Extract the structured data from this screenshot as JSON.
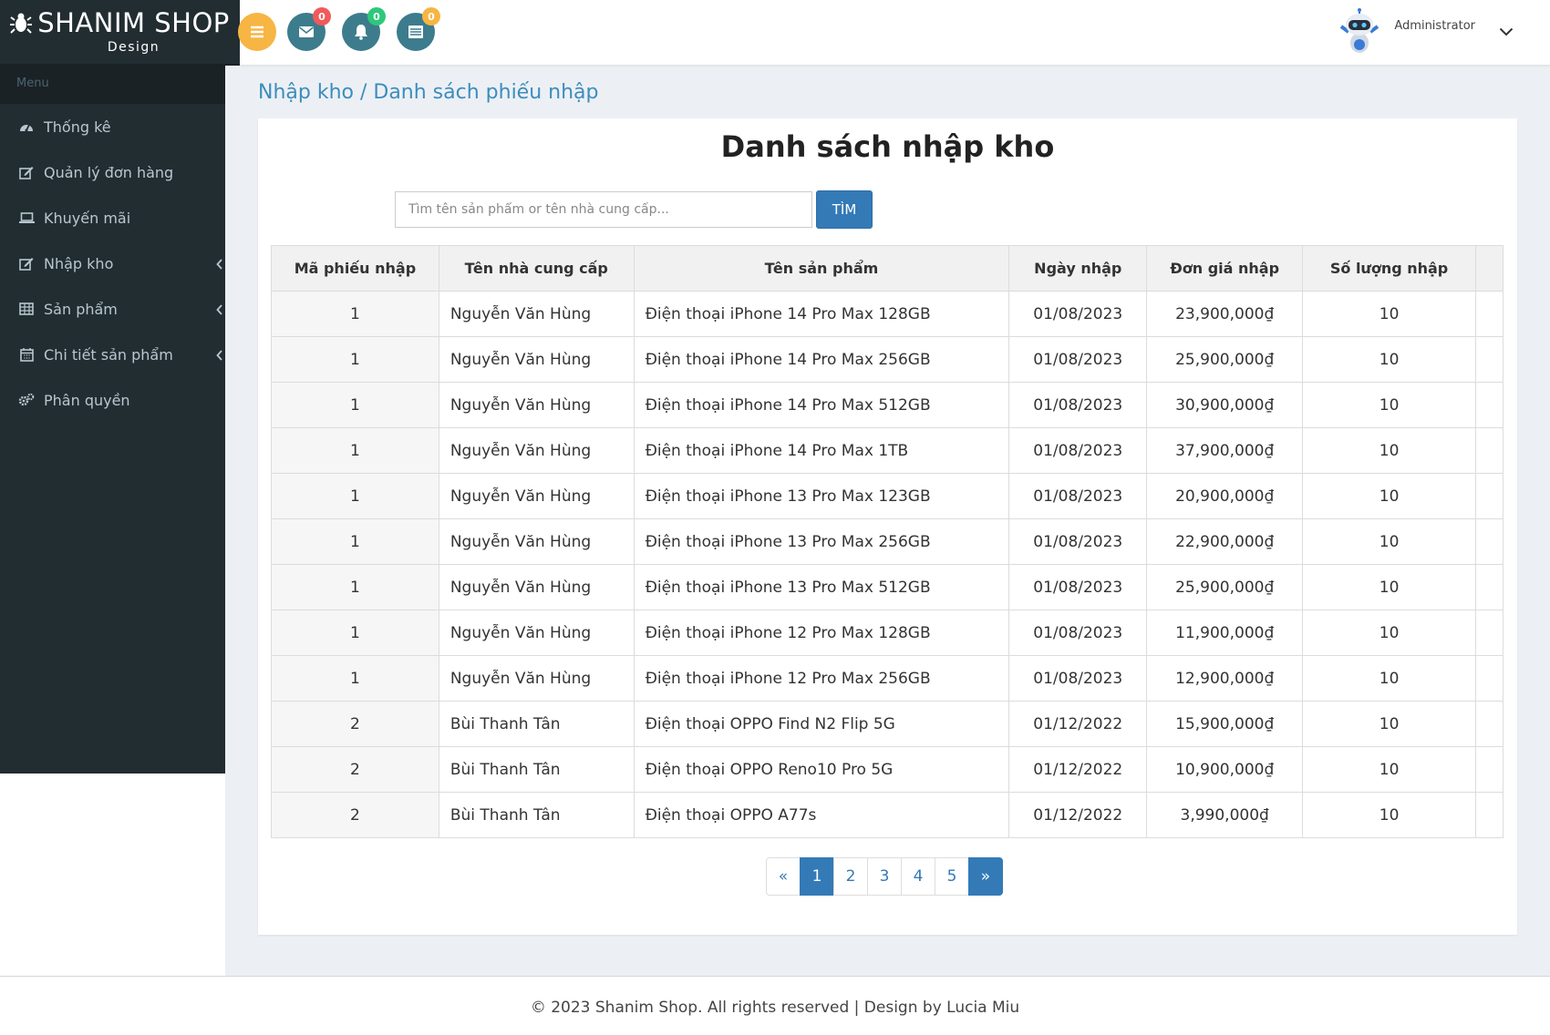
{
  "brand": {
    "title": "SHANIM SHOP",
    "subtitle": "Design"
  },
  "sidebar": {
    "header": "Menu",
    "items": [
      {
        "label": "Thống kê",
        "icon": "dashboard-icon"
      },
      {
        "label": "Quản lý đơn hàng",
        "icon": "edit-icon"
      },
      {
        "label": "Khuyến mãi",
        "icon": "laptop-icon"
      },
      {
        "label": "Nhập kho",
        "icon": "edit-icon",
        "chevron": true
      },
      {
        "label": "Sản phẩm",
        "icon": "table-icon",
        "chevron": true
      },
      {
        "label": "Chi tiết sản phẩm",
        "icon": "calendar-icon",
        "chevron": true
      },
      {
        "label": "Phân quyền",
        "icon": "cogs-icon"
      }
    ]
  },
  "topbar": {
    "badges": {
      "mail": "0",
      "bell": "0",
      "tasks": "0"
    },
    "user_name": "Administrator"
  },
  "breadcrumb": "Nhập kho / Danh sách phiếu nhập",
  "panel": {
    "title": "Danh sách nhập kho",
    "search_placeholder": "Tìm tên sản phẩm or tên nhà cung cấp...",
    "search_button": "TÌM"
  },
  "table": {
    "headers": [
      "Mã phiếu nhập",
      "Tên nhà cung cấp",
      "Tên sản phẩm",
      "Ngày nhập",
      "Đơn giá nhập",
      "Số lượng nhập",
      ""
    ],
    "rows": [
      [
        "1",
        "Nguyễn Văn Hùng",
        "Điện thoại iPhone 14 Pro Max 128GB",
        "01/08/2023",
        "23,900,000₫",
        "10"
      ],
      [
        "1",
        "Nguyễn Văn Hùng",
        "Điện thoại iPhone 14 Pro Max 256GB",
        "01/08/2023",
        "25,900,000₫",
        "10"
      ],
      [
        "1",
        "Nguyễn Văn Hùng",
        "Điện thoại iPhone 14 Pro Max 512GB",
        "01/08/2023",
        "30,900,000₫",
        "10"
      ],
      [
        "1",
        "Nguyễn Văn Hùng",
        "Điện thoại iPhone 14 Pro Max 1TB",
        "01/08/2023",
        "37,900,000₫",
        "10"
      ],
      [
        "1",
        "Nguyễn Văn Hùng",
        "Điện thoại iPhone 13 Pro Max 123GB",
        "01/08/2023",
        "20,900,000₫",
        "10"
      ],
      [
        "1",
        "Nguyễn Văn Hùng",
        "Điện thoại iPhone 13 Pro Max 256GB",
        "01/08/2023",
        "22,900,000₫",
        "10"
      ],
      [
        "1",
        "Nguyễn Văn Hùng",
        "Điện thoại iPhone 13 Pro Max 512GB",
        "01/08/2023",
        "25,900,000₫",
        "10"
      ],
      [
        "1",
        "Nguyễn Văn Hùng",
        "Điện thoại iPhone 12 Pro Max 128GB",
        "01/08/2023",
        "11,900,000₫",
        "10"
      ],
      [
        "1",
        "Nguyễn Văn Hùng",
        "Điện thoại iPhone 12 Pro Max 256GB",
        "01/08/2023",
        "12,900,000₫",
        "10"
      ],
      [
        "2",
        "Bùi Thanh Tân",
        "Điện thoại OPPO Find N2 Flip 5G",
        "01/12/2022",
        "15,900,000₫",
        "10"
      ],
      [
        "2",
        "Bùi Thanh Tân",
        "Điện thoại OPPO Reno10 Pro 5G",
        "01/12/2022",
        "10,900,000₫",
        "10"
      ],
      [
        "2",
        "Bùi Thanh Tân",
        "Điện thoại OPPO A77s",
        "01/12/2022",
        "3,990,000₫",
        "10"
      ]
    ]
  },
  "pagination": {
    "prev": "«",
    "pages": [
      "1",
      "2",
      "3",
      "4",
      "5"
    ],
    "next": "»",
    "active": "1"
  },
  "footer": "© 2023 Shanim Shop. All rights reserved | Design by Lucia Miu",
  "colors": {
    "sidebar": "#222d32",
    "accent": "#337ab7",
    "menu_button": "#f7b543"
  }
}
